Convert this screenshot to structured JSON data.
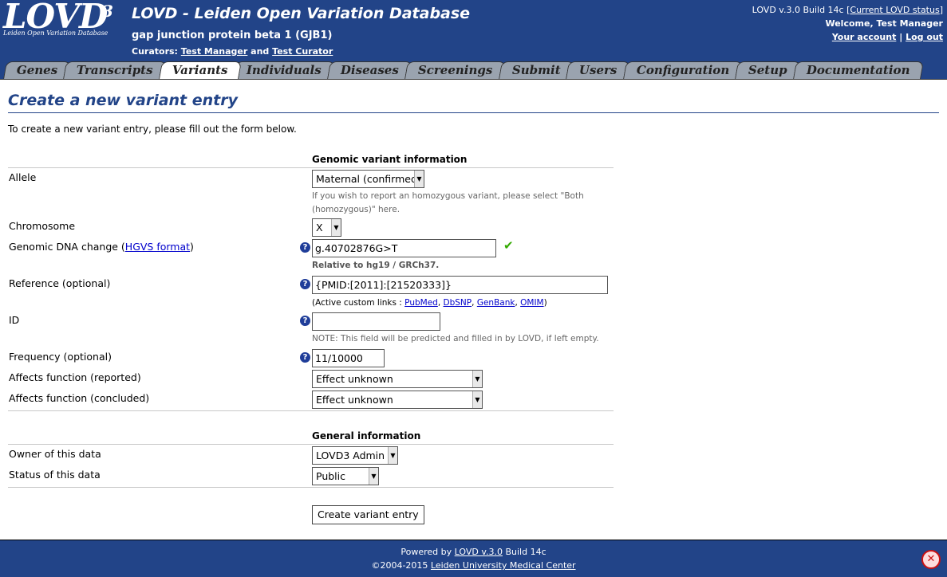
{
  "header": {
    "logo_text": "LOVD",
    "logo_sup": "3",
    "logo_subtitle": "Leiden Open Variation Database",
    "app_title": "LOVD - Leiden Open Variation Database",
    "gene_title": "gap junction protein beta 1 (GJB1)",
    "curators_prefix": "Curators:",
    "curator_1": "Test Manager",
    "curators_and": "and",
    "curator_2": "Test Curator",
    "version": "LOVD v.3.0 Build 14c [",
    "status_link": "Current LOVD status",
    "version_end": "]",
    "welcome": "Welcome, Test Manager",
    "account_link": "Your account",
    "separator": "|",
    "logout_link": "Log out"
  },
  "tabs": [
    "Genes",
    "Transcripts",
    "Variants",
    "Individuals",
    "Diseases",
    "Screenings",
    "Submit",
    "Users",
    "Configuration",
    "Setup",
    "Documentation"
  ],
  "active_tab": "Variants",
  "page": {
    "title": "Create a new variant entry",
    "intro": "To create a new variant entry, please fill out the form below."
  },
  "form": {
    "section_genomic": "Genomic variant information",
    "allele_label": "Allele",
    "allele_value": "Maternal (confirmed)",
    "allele_note": "If you wish to report an homozygous variant, please select \"Both (homozygous)\" here.",
    "chromosome_label": "Chromosome",
    "chromosome_value": "X",
    "dna_label_prefix": "Genomic DNA change (",
    "dna_label_link": "HGVS format",
    "dna_label_suffix": ")",
    "dna_value": "g.40702876G>T",
    "dna_note": "Relative to hg19 / GRCh37.",
    "reference_label": "Reference (optional)",
    "reference_value": "{PMID:[2011]:[21520333]}",
    "links_prefix": "(Active custom links : ",
    "link_pubmed": "PubMed",
    "link_dbsnp": "DbSNP",
    "link_genbank": "GenBank",
    "link_omim": "OMIM",
    "links_suffix": ")",
    "id_label": "ID",
    "id_value": "",
    "id_note": "NOTE: This field will be predicted and filled in by LOVD, if left empty.",
    "frequency_label": "Frequency (optional)",
    "frequency_value": "11/10000",
    "affects_reported_label": "Affects function (reported)",
    "affects_reported_value": "Effect unknown",
    "affects_concluded_label": "Affects function (concluded)",
    "affects_concluded_value": "Effect unknown",
    "section_general": "General information",
    "owner_label": "Owner of this data",
    "owner_value": "LOVD3 Admin",
    "status_label": "Status of this data",
    "status_value": "Public",
    "submit_label": "Create variant entry"
  },
  "footer": {
    "powered_prefix": "Powered by",
    "powered_link": "LOVD v.3.0",
    "powered_suffix": "Build 14c",
    "copyright_prefix": "©2004-2015",
    "copyright_link": "Leiden University Medical Center"
  }
}
